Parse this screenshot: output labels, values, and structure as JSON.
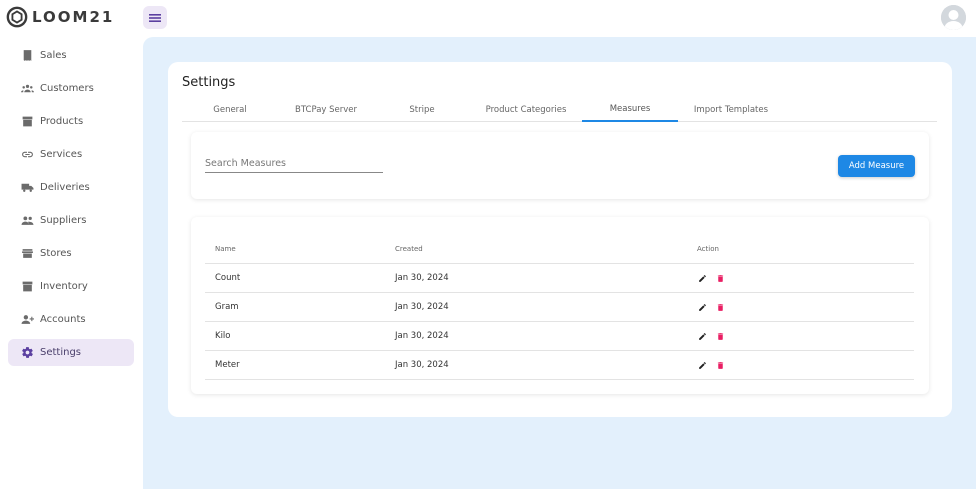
{
  "app": {
    "logo_text": "LOOM21"
  },
  "sidebar": {
    "items": [
      {
        "label": "Sales",
        "icon": "receipt-icon"
      },
      {
        "label": "Customers",
        "icon": "people-icon"
      },
      {
        "label": "Products",
        "icon": "archive-icon"
      },
      {
        "label": "Services",
        "icon": "link-icon"
      },
      {
        "label": "Deliveries",
        "icon": "truck-icon"
      },
      {
        "label": "Suppliers",
        "icon": "group-icon"
      },
      {
        "label": "Stores",
        "icon": "store-icon"
      },
      {
        "label": "Inventory",
        "icon": "box-icon"
      },
      {
        "label": "Accounts",
        "icon": "person-add-icon"
      },
      {
        "label": "Settings",
        "icon": "gear-icon",
        "active": true
      }
    ]
  },
  "page": {
    "title": "Settings"
  },
  "tabs": [
    {
      "label": "General"
    },
    {
      "label": "BTCPay Server"
    },
    {
      "label": "Stripe"
    },
    {
      "label": "Product Categories"
    },
    {
      "label": "Measures",
      "active": true
    },
    {
      "label": "Import Templates"
    }
  ],
  "search": {
    "placeholder": "Search Measures",
    "value": ""
  },
  "add_button_label": "Add Measure",
  "table": {
    "headers": {
      "name": "Name",
      "created": "Created",
      "action": "Action"
    },
    "rows": [
      {
        "name": "Count",
        "created": "Jan 30, 2024"
      },
      {
        "name": "Gram",
        "created": "Jan 30, 2024"
      },
      {
        "name": "Kilo",
        "created": "Jan 30, 2024"
      },
      {
        "name": "Meter",
        "created": "Jan 30, 2024"
      }
    ]
  },
  "colors": {
    "accent": "#1e88e5",
    "active_nav_bg": "#ede7f6",
    "main_bg": "#e3f0fc",
    "delete_icon": "#e91e63"
  }
}
